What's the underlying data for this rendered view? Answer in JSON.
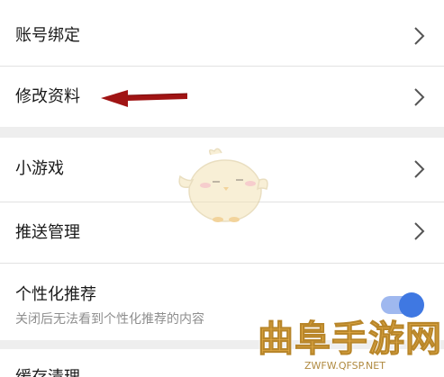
{
  "settings": {
    "items": [
      {
        "label": "账号绑定"
      },
      {
        "label": "修改资料"
      },
      {
        "label": "小游戏"
      },
      {
        "label": "推送管理"
      }
    ],
    "personalized": {
      "label": "个性化推荐",
      "description": "关闭后无法看到个性化推荐的内容",
      "enabled": true
    },
    "partial_item": {
      "label": "缓存清理"
    }
  },
  "colors": {
    "toggle_on": "#3f78e2",
    "annotation_arrow": "#a01414",
    "watermark": "#e8b04a"
  },
  "watermark": {
    "title": "曲阜手游网",
    "url": "ZWFW.QFSP.NET"
  }
}
